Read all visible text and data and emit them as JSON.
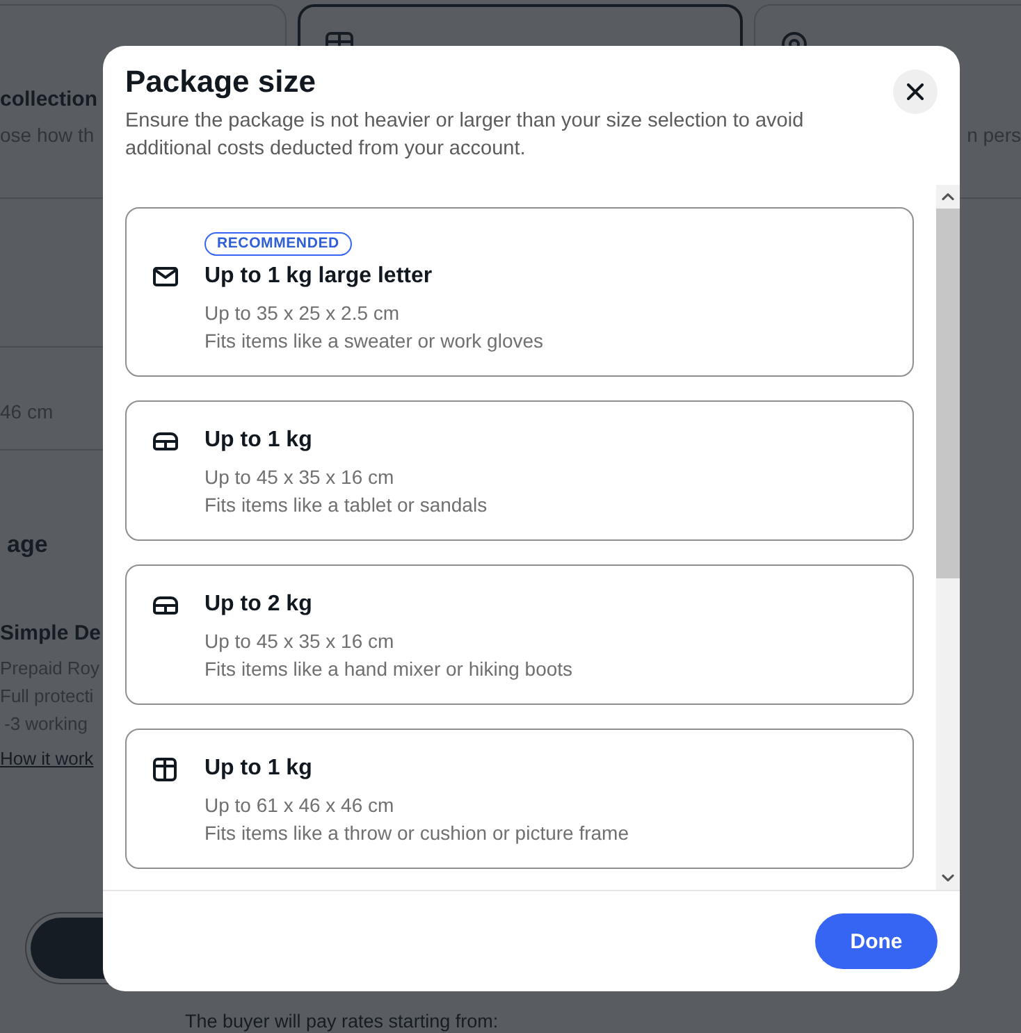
{
  "background_page": {
    "delivery_options": [
      {
        "title": "collection",
        "description": "ose how th",
        "selected": false
      },
      {
        "kind": "parcel",
        "selected": true
      },
      {
        "kind": "place",
        "description": "n pers",
        "selected": false
      }
    ],
    "size_row": "46 cm",
    "section_heading": "age",
    "service": {
      "title": "Simple De",
      "lines": [
        "Prepaid Roy",
        "Full protecti",
        "-3 working"
      ],
      "link": "How it work"
    },
    "note": "The buyer will pay rates starting from:"
  },
  "dialog": {
    "title": "Package size",
    "description": "Ensure the package is not heavier or larger than your size selection to avoid additional costs deducted from your account.",
    "options": [
      {
        "kind": "letter",
        "badge": "RECOMMENDED",
        "title": "Up to 1 kg large letter",
        "dimensions": "Up to 35 x 25 x 2.5 cm",
        "examples": "Fits items like a sweater or work gloves",
        "selected": false
      },
      {
        "kind": "small_parcel",
        "title": "Up to 1 kg",
        "dimensions": "Up to 45 x 35 x 16 cm",
        "examples": "Fits items like a tablet or sandals",
        "selected": false
      },
      {
        "kind": "small_parcel",
        "title": "Up to 2 kg",
        "dimensions": "Up to 45 x 35 x 16 cm",
        "examples": "Fits items like a hand mixer or hiking boots",
        "selected": false
      },
      {
        "kind": "medium_parcel",
        "title": "Up to 1 kg",
        "dimensions": "Up to 61 x 46 x 46 cm",
        "examples": "Fits items like a throw or cushion or picture frame",
        "selected": false
      }
    ],
    "done_button": "Done"
  }
}
